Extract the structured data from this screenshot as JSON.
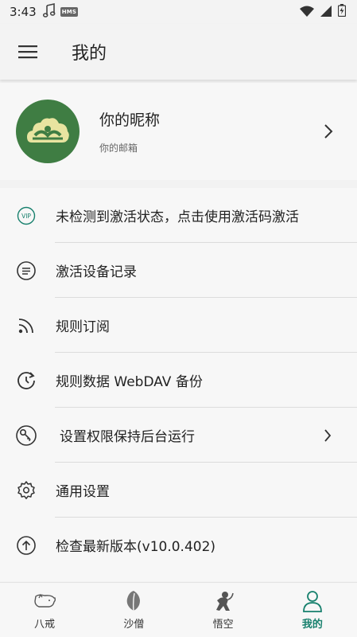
{
  "status_bar": {
    "time": "3:43",
    "hms_badge": "HMS"
  },
  "app_bar": {
    "title": "我的"
  },
  "profile": {
    "nickname": "你的昵称",
    "email": "你的邮箱"
  },
  "menu": {
    "items": [
      {
        "label": "未检测到激活状态，点击使用激活码激活",
        "icon": "vip-icon"
      },
      {
        "label": "激活设备记录",
        "icon": "list-circle-icon"
      },
      {
        "label": "规则订阅",
        "icon": "rss-icon"
      },
      {
        "label": "规则数据 WebDAV 备份",
        "icon": "backup-clock-icon"
      },
      {
        "label": "设置权限保持后台运行",
        "icon": "key-icon"
      },
      {
        "label": "通用设置",
        "icon": "gear-icon"
      },
      {
        "label": "检查最新版本(v10.0.402)",
        "icon": "upload-circle-icon"
      }
    ]
  },
  "bottom_nav": {
    "tabs": [
      {
        "label": "八戒",
        "icon": "pig-icon"
      },
      {
        "label": "沙僧",
        "icon": "leaf-icon"
      },
      {
        "label": "悟空",
        "icon": "monkey-icon"
      },
      {
        "label": "我的",
        "icon": "person-icon",
        "active": true
      }
    ]
  },
  "colors": {
    "accent": "#17806d",
    "avatar_bg": "#3f7d43",
    "avatar_cloud": "#e8e4a0"
  }
}
